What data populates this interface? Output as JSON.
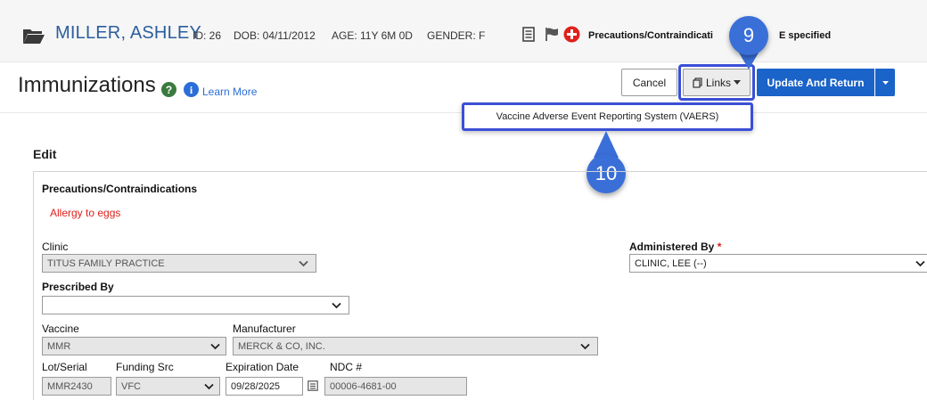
{
  "banner": {
    "patient_name": "MILLER, ASHLEY",
    "id": "ID: 26",
    "dob": "DOB: 04/11/2012",
    "age": "AGE: 11Y 6M 0D",
    "gender": "GENDER: F",
    "precautions_left": "Precautions/Contraindicati",
    "precautions_right": "E specified"
  },
  "header": {
    "title": "Immunizations",
    "learn_more": "Learn More",
    "cancel_label": "Cancel",
    "links_label": "Links",
    "update_label": "Update And Return"
  },
  "links_menu": {
    "items": [
      "Vaccine Adverse Event Reporting System (VAERS)"
    ]
  },
  "callouts": [
    "9",
    "10"
  ],
  "form": {
    "section_title": "Edit",
    "precautions_label": "Precautions/Contraindications",
    "allergy": "Allergy to eggs",
    "clinic_label": "Clinic",
    "clinic_value": "TITUS FAMILY PRACTICE",
    "administered_by_label": "Administered By",
    "required_marker": "*",
    "administered_by_value": "CLINIC, LEE (--)",
    "prescribed_by_label": "Prescribed By",
    "prescribed_by_value": "",
    "vaccine_label": "Vaccine",
    "vaccine_value": "MMR",
    "manufacturer_label": "Manufacturer",
    "manufacturer_value": "MERCK & CO, INC.",
    "lot_label": "Lot/Serial",
    "lot_value": "MMR2430",
    "funding_label": "Funding Src",
    "funding_value": "VFC",
    "expiration_label": "Expiration Date",
    "expiration_value": "09/28/2025",
    "ndc_label": "NDC #",
    "ndc_value": "00006-4681-00"
  },
  "colors": {
    "accent": "#1a63c8",
    "callout": "#3a6fd8",
    "highlight": "#3a4fd6",
    "alert": "#e0201c"
  }
}
